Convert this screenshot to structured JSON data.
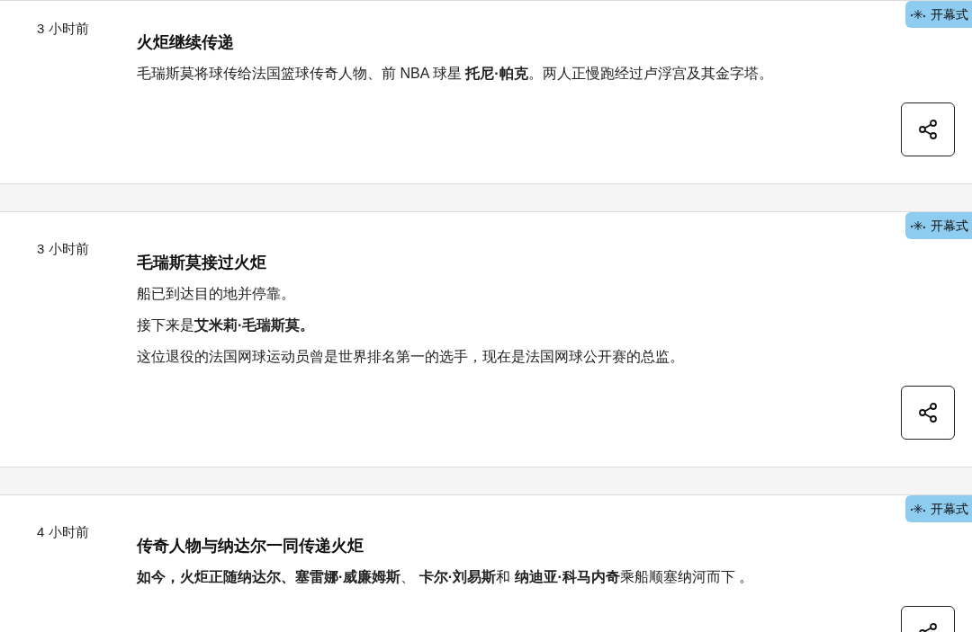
{
  "posts": [
    {
      "time": "3 小时前",
      "badge": "开幕式",
      "title": "火炬继续传递",
      "paragraphs": [
        "毛瑞斯莫将球传给法国篮球传奇人物、前 NBA 球星 **托尼·帕克**。两人正慢跑经过卢浮宫及其金字塔。"
      ]
    },
    {
      "time": "3 小时前",
      "badge": "开幕式",
      "title": "毛瑞斯莫接过火炬",
      "paragraphs": [
        "船已到达目的地并停靠。",
        "接下来是**艾米莉·毛瑞斯莫。**",
        "这位退役的法国网球运动员曾是世界排名第一的选手，现在是法国网球公开赛的总监。"
      ]
    },
    {
      "time": "4 小时前",
      "badge": "开幕式",
      "title": "传奇人物与纳达尔一同传递火炬",
      "paragraphs": [
        "**如今，火炬正随纳达尔、塞雷娜·威廉姆斯**、 **卡尔·刘易斯**和 **纳迪亚·科马内奇**乘船顺塞纳河而下 。"
      ]
    }
  ]
}
